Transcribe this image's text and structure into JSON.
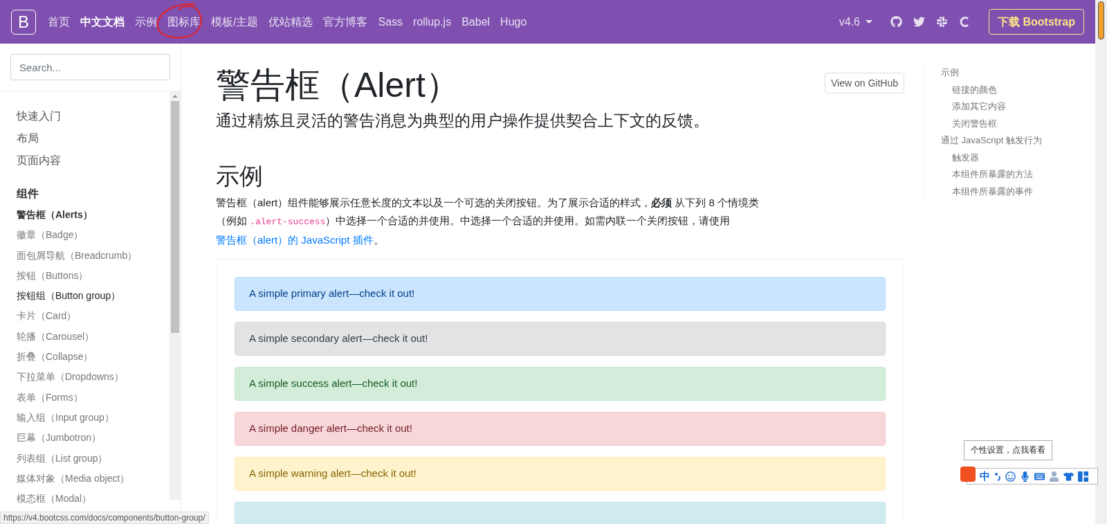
{
  "navbar": {
    "logo": "B",
    "links": [
      {
        "label": "首页",
        "selected": false
      },
      {
        "label": "中文文档",
        "selected": true
      },
      {
        "label": "示例",
        "selected": false
      },
      {
        "label": "图标库",
        "selected": false
      },
      {
        "label": "模板/主题",
        "selected": false
      },
      {
        "label": "优站精选",
        "selected": false
      },
      {
        "label": "官方博客",
        "selected": false
      },
      {
        "label": "Sass",
        "selected": false
      },
      {
        "label": "rollup.js",
        "selected": false
      },
      {
        "label": "Babel",
        "selected": false
      },
      {
        "label": "Hugo",
        "selected": false
      }
    ],
    "version": "v4.6",
    "download": "下载 Bootstrap"
  },
  "sidebar": {
    "search": {
      "placeholder": "Search..."
    },
    "sections": [
      {
        "label": "快速入门"
      },
      {
        "label": "布局"
      },
      {
        "label": "页面内容"
      }
    ],
    "group": {
      "label": "组件",
      "items": [
        {
          "label": "警告框（Alerts）",
          "selected": true,
          "hovered": false
        },
        {
          "label": "徽章（Badge）",
          "selected": false,
          "hovered": false
        },
        {
          "label": "面包屑导航（Breadcrumb）",
          "selected": false,
          "hovered": false
        },
        {
          "label": "按钮（Buttons）",
          "selected": false,
          "hovered": false
        },
        {
          "label": "按钮组（Button group）",
          "selected": false,
          "hovered": true
        },
        {
          "label": "卡片（Card）",
          "selected": false,
          "hovered": false
        },
        {
          "label": "轮播（Carousel）",
          "selected": false,
          "hovered": false
        },
        {
          "label": "折叠（Collapse）",
          "selected": false,
          "hovered": false
        },
        {
          "label": "下拉菜单（Dropdowns）",
          "selected": false,
          "hovered": false
        },
        {
          "label": "表单（Forms）",
          "selected": false,
          "hovered": false
        },
        {
          "label": "输入组（Input group）",
          "selected": false,
          "hovered": false
        },
        {
          "label": "巨幕（Jumbotron）",
          "selected": false,
          "hovered": false
        },
        {
          "label": "列表组（List group）",
          "selected": false,
          "hovered": false
        },
        {
          "label": "媒体对象（Media object）",
          "selected": false,
          "hovered": false
        },
        {
          "label": "模态框（Modal）",
          "selected": false,
          "hovered": false
        }
      ]
    }
  },
  "main": {
    "title": "警告框（Alert）",
    "github_button": "View on GitHub",
    "lead": "通过精炼且灵活的警告消息为典型的用户操作提供契合上下文的反馈。",
    "heading": "示例",
    "paragraph": [
      {
        "kind": "text",
        "text": "警告框（alert）组件能够展示任意长度的文本以及一个可选的关闭按钮。为了展示合适的样式，**必须** 从下列 8 个情境类（例如 "
      },
      {
        "kind": "code",
        "text": ".alert-success"
      },
      {
        "kind": "text",
        "text": "）中选择一个合适的并使用。中选择一个合适的并使用。如需内联一个关闭按钮，请使用 "
      },
      {
        "kind": "link",
        "text": "警告框（alert）的 JavaScript 插件"
      },
      {
        "kind": "text",
        "text": "。"
      }
    ],
    "alerts": [
      {
        "kind": "primary",
        "text": "A simple primary alert—check it out!"
      },
      {
        "kind": "secondary",
        "text": "A simple secondary alert—check it out!"
      },
      {
        "kind": "success",
        "text": "A simple success alert—check it out!"
      },
      {
        "kind": "danger",
        "text": "A simple danger alert—check it out!"
      },
      {
        "kind": "warning",
        "text": "A simple warning alert—check it out!"
      },
      {
        "kind": "info"
      }
    ]
  },
  "toc": [
    {
      "label": "示例",
      "children": [
        {
          "label": "链接的颜色"
        },
        {
          "label": "添加其它内容"
        },
        {
          "label": "关闭警告框"
        }
      ]
    },
    {
      "label": "通过 JavaScript 触发行为",
      "children": [
        {
          "label": "触发器"
        },
        {
          "label": "本组件所暴露的方法"
        },
        {
          "label": "本组件所暴露的事件"
        }
      ]
    }
  ],
  "status_url": "https://v4.bootcss.com/docs/components/button-group/",
  "ime": {
    "tooltip": "个性设置，点我看看",
    "mode": "中"
  }
}
